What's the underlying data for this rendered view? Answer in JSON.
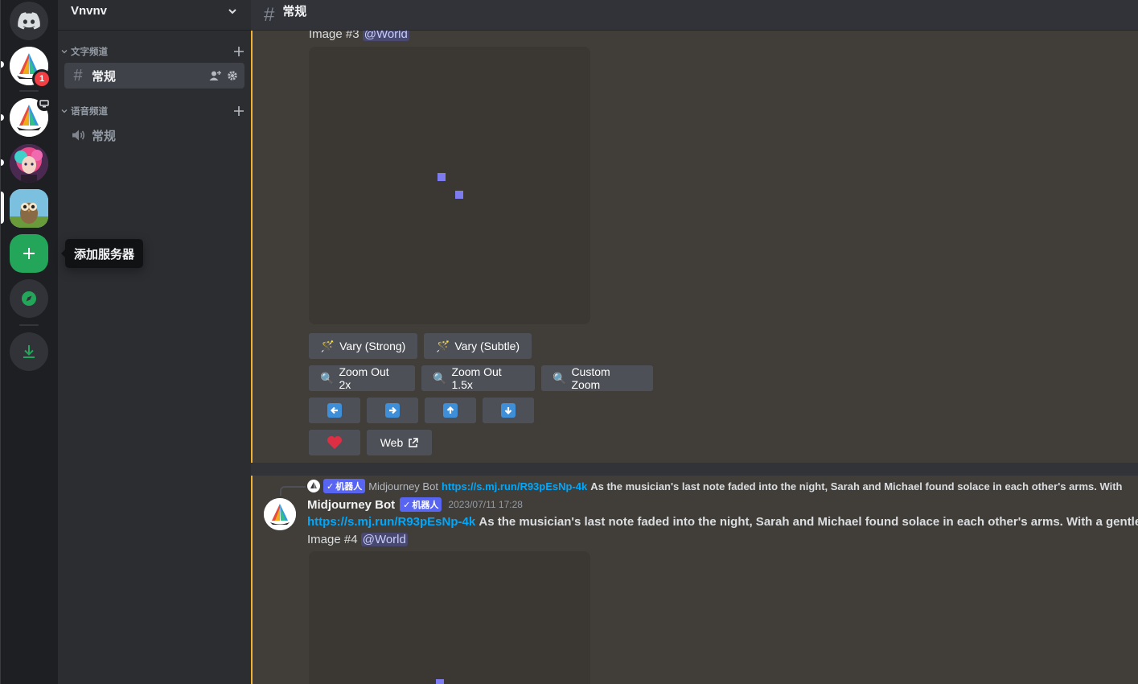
{
  "server": {
    "name": "Vnvnv",
    "unread_badge": "1",
    "add_tooltip": "添加服务器"
  },
  "sidebar": {
    "text_category": "文字频道",
    "voice_category": "语音频道",
    "text_channel": "常规",
    "voice_channel": "常规"
  },
  "header": {
    "channel_name": "常规"
  },
  "message1": {
    "image_label": "Image #3",
    "mention": "@World",
    "buttons": {
      "vary_strong": "Vary (Strong)",
      "vary_subtle": "Vary (Subtle)",
      "zoom_out_2x": "Zoom Out 2x",
      "zoom_out_15x": "Zoom Out 1.5x",
      "custom_zoom": "Custom Zoom",
      "web": "Web"
    }
  },
  "message2": {
    "reply": {
      "bot_tag": "机器人",
      "author": "Midjourney Bot",
      "link": "https://s.mj.run/R93pEsNp-4k",
      "text": "As the musician's last note faded into the night, Sarah and Michael found solace in each other's arms. With"
    },
    "author": "Midjourney Bot",
    "bot_tag": "机器人",
    "timestamp": "2023/07/11 17:28",
    "link": "https://s.mj.run/R93pEsNp-4k",
    "text": "As the musician's last note faded into the night, Sarah and Michael found solace in each other's arms. With a gentle",
    "image_label": "Image #4",
    "mention": "@World"
  },
  "colors": {
    "highlight_bg": "#413d38",
    "highlight_border": "#f0b232",
    "blurple": "#5865f2",
    "link": "#00a8fc",
    "green": "#23a55a"
  }
}
